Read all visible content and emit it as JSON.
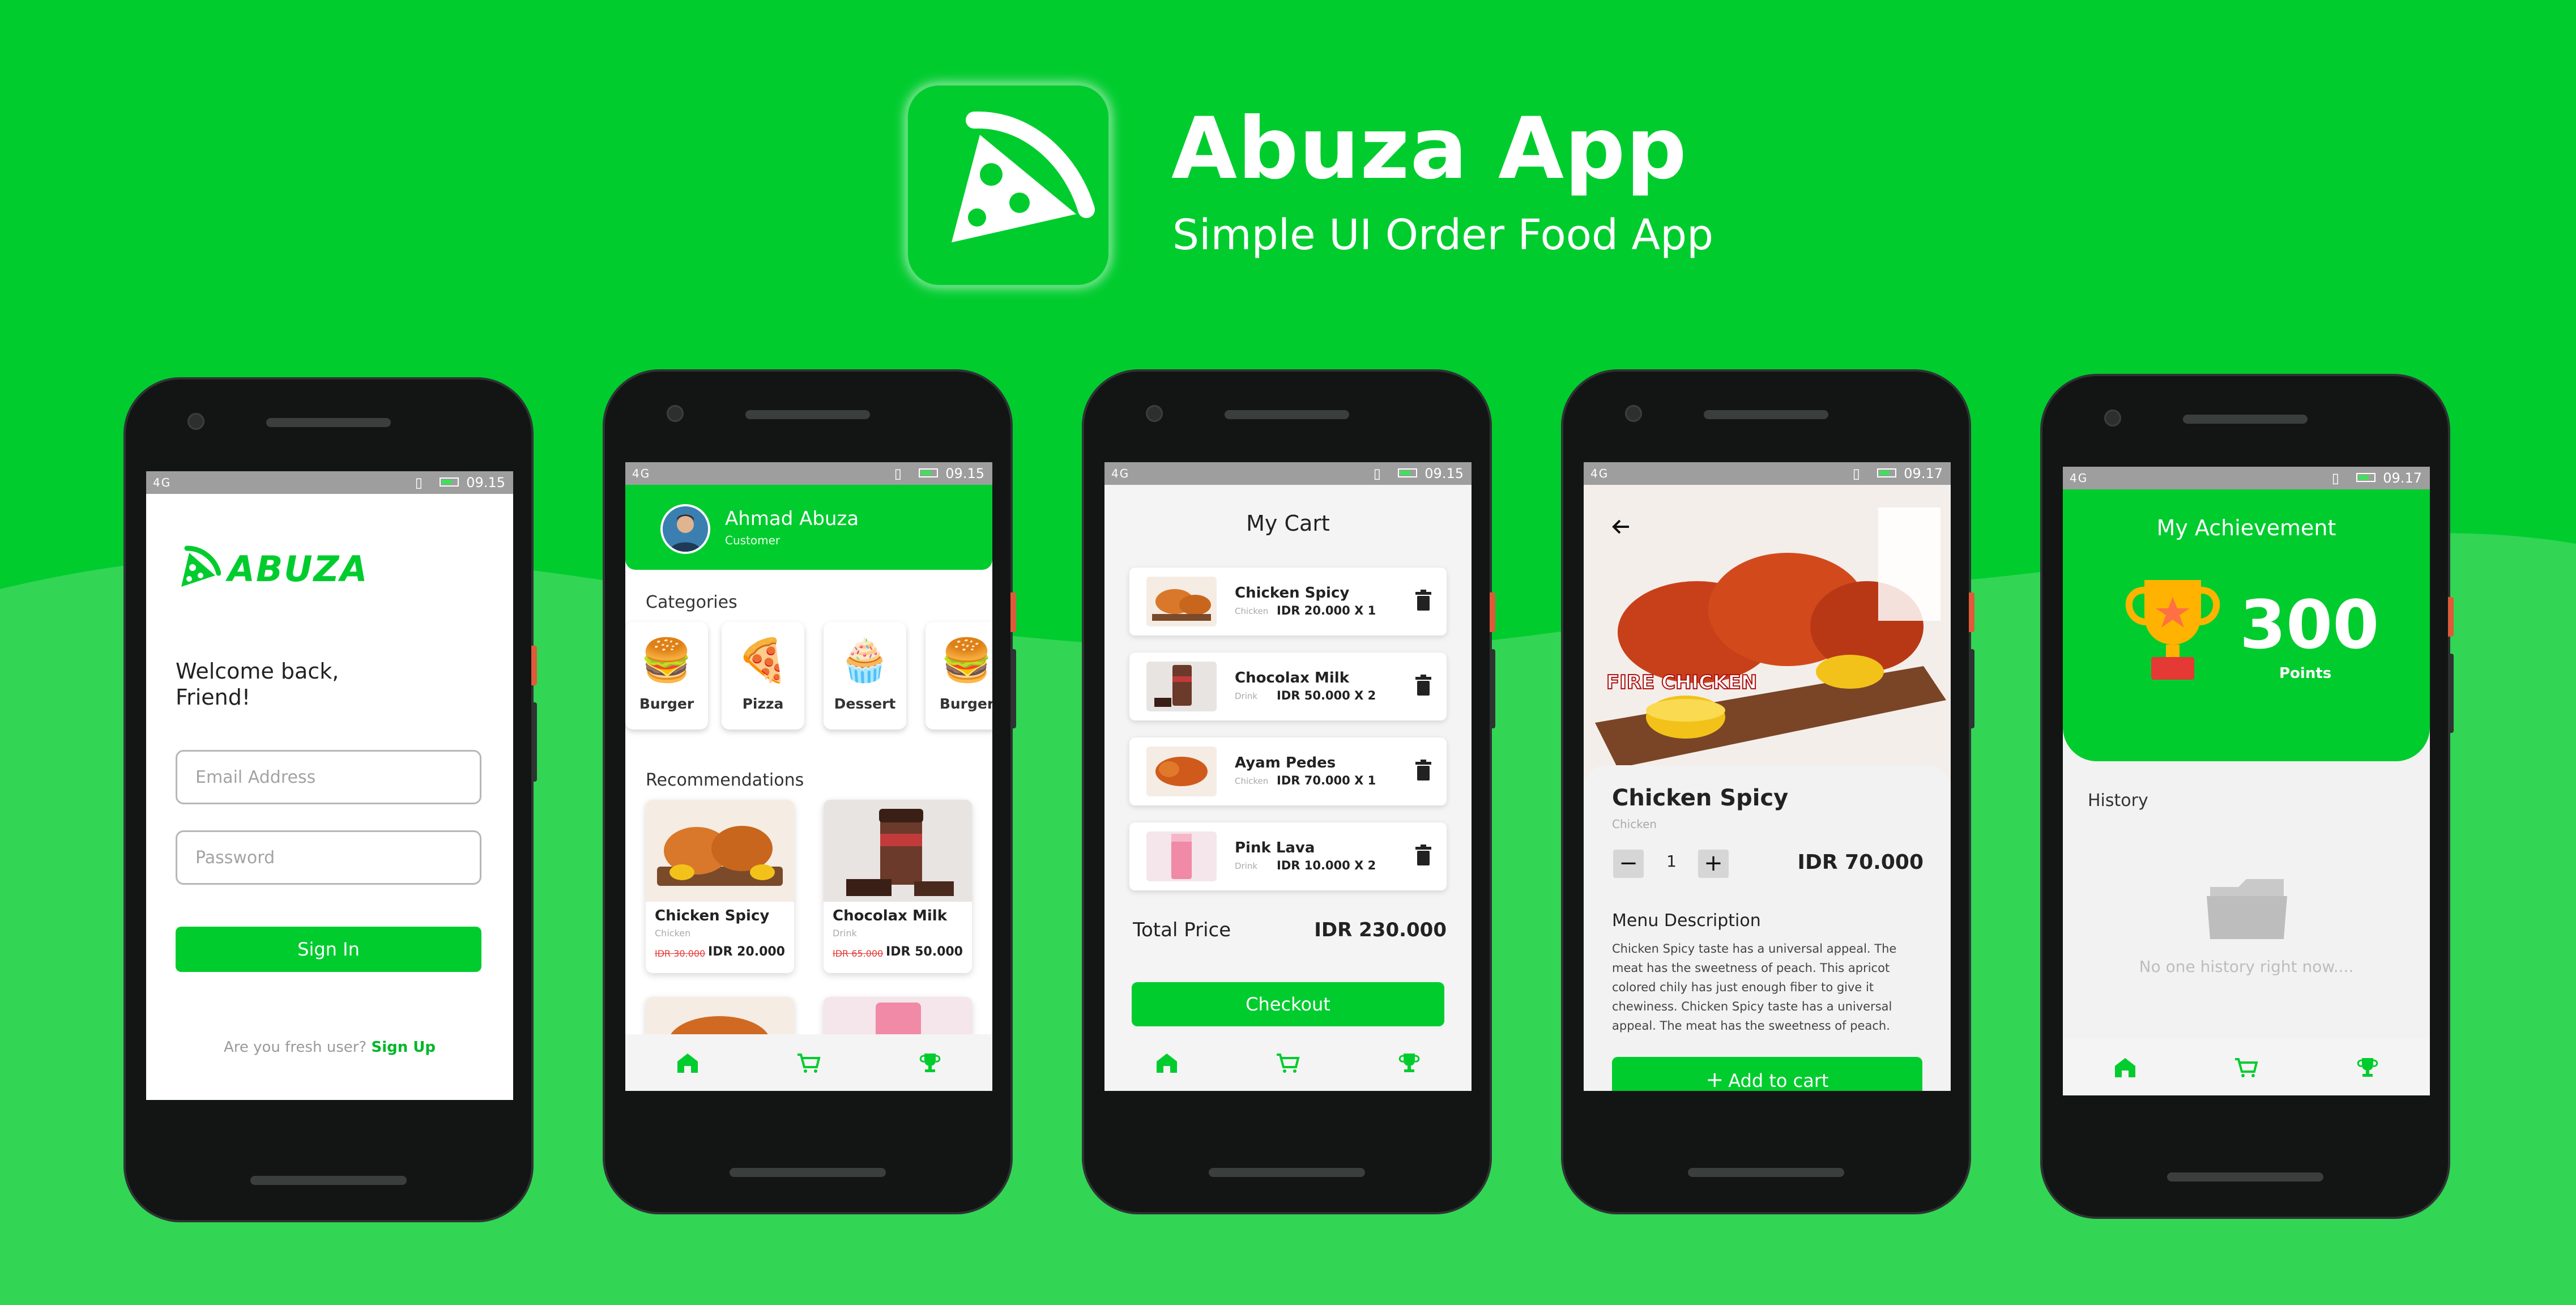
{
  "colors": {
    "brand_green": "#00cc2e",
    "phone_body": "#131515",
    "status_bar": "#9e9e9e",
    "price_strike": "#e53935"
  },
  "header": {
    "title": "Abuza App",
    "subtitle": "Simple UI Order Food App",
    "icon": "pizza-slice-icon"
  },
  "status_bar": {
    "signal_text": "4G",
    "time_login": "09.15",
    "time_home": "09.15",
    "time_cart": "09.15",
    "time_detail": "09.17",
    "time_achievement": "09.17"
  },
  "login": {
    "logo_text": "ABUZA",
    "welcome": "Welcome back,\nFriend!",
    "email_placeholder": "Email Address",
    "password_placeholder": "Password",
    "sign_in": "Sign In",
    "fresh_prompt": "Are you fresh user?",
    "sign_up": "Sign Up"
  },
  "home": {
    "user_name": "Ahmad Abuza",
    "user_role": "Customer",
    "categories_title": "Categories",
    "categories": [
      {
        "label": "Burger",
        "icon": "burger-icon"
      },
      {
        "label": "Pizza",
        "icon": "pizza-icon"
      },
      {
        "label": "Dessert",
        "icon": "cupcake-icon"
      },
      {
        "label": "Burger",
        "icon": "burger-icon"
      }
    ],
    "recommendations_title": "Recommendations",
    "recommendations": [
      {
        "name": "Chicken Spicy",
        "category": "Chicken",
        "old_price": "IDR 30.000",
        "price": "IDR 20.000"
      },
      {
        "name": "Chocolax Milk",
        "category": "Drink",
        "old_price": "IDR 65.000",
        "price": "IDR 50.000"
      }
    ]
  },
  "cart": {
    "title": "My Cart",
    "items": [
      {
        "name": "Chicken Spicy",
        "category": "Chicken",
        "price": "IDR 20.000  X  1"
      },
      {
        "name": "Chocolax Milk",
        "category": "Drink",
        "price": "IDR 50.000  X  2"
      },
      {
        "name": "Ayam Pedes",
        "category": "Chicken",
        "price": "IDR 70.000  X  1"
      },
      {
        "name": "Pink Lava",
        "category": "Drink",
        "price": "IDR 10.000  X  2"
      }
    ],
    "total_label": "Total Price",
    "total_value": "IDR 230.000",
    "checkout": "Checkout"
  },
  "detail": {
    "image_text": "FIRE CHICKEN",
    "name": "Chicken Spicy",
    "category": "Chicken",
    "quantity": "1",
    "minus": "−",
    "plus": "+",
    "price": "IDR 70.000",
    "desc_title": "Menu Description",
    "description": "Chicken Spicy taste has a universal appeal. The meat has the sweetness of peach. This apricot colored chily has just enough fiber to give it chewiness. Chicken Spicy taste has a universal appeal. The meat has the sweetness of peach.",
    "add_to_cart": "Add to cart"
  },
  "achievement": {
    "title": "My Achievement",
    "points": "300",
    "points_label": "Points",
    "history_title": "History",
    "empty_text": "No one history right now...."
  },
  "nav": {
    "icons": [
      "home-icon",
      "cart-icon",
      "trophy-icon"
    ]
  }
}
